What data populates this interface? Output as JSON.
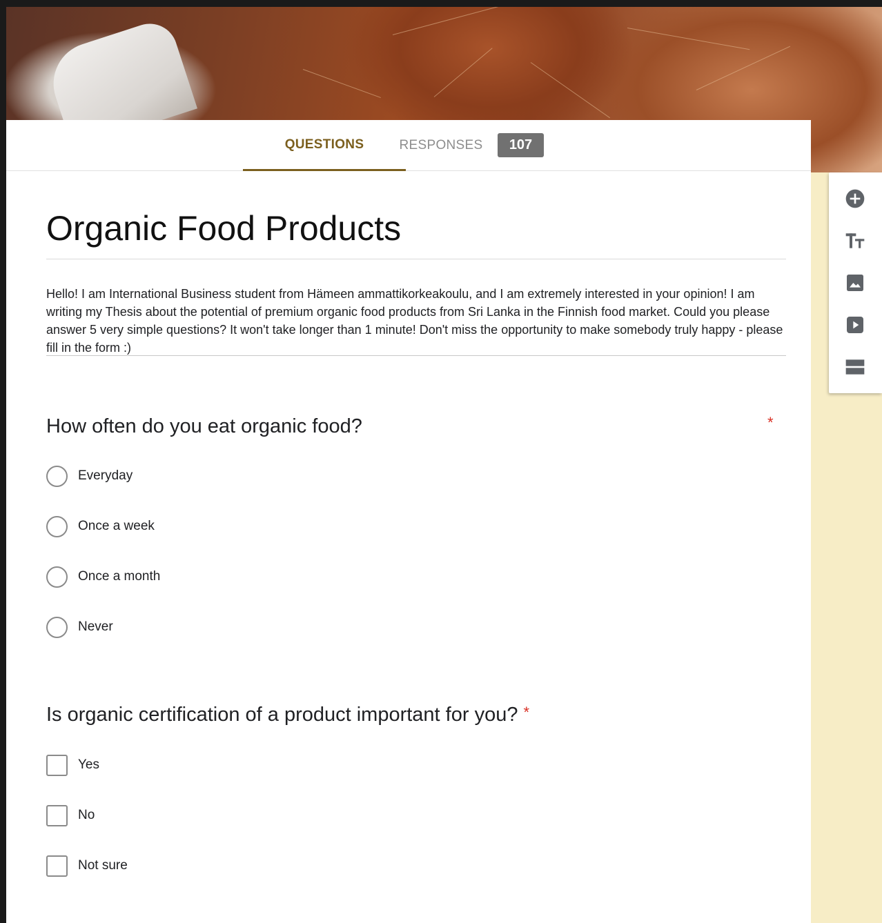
{
  "tabs": {
    "questions_label": "QUESTIONS",
    "responses_label": "RESPONSES",
    "responses_count": "107"
  },
  "form": {
    "title": "Organic Food Products",
    "description": "Hello! I am International Business student from Hämeen ammattikorkeakoulu, and I am extremely interested in your opinion! I am writing my Thesis about the potential of premium organic food products from Sri Lanka in the Finnish food market. Could you please answer 5 very simple questions? It won't take longer than 1 minute! Don't miss the opportunity to make somebody truly happy - please fill in the form :)"
  },
  "questions": [
    {
      "text": "How often do you eat organic food?",
      "required_mark": "*",
      "type": "radio",
      "options": [
        "Everyday",
        "Once a week",
        "Once a month",
        "Never"
      ]
    },
    {
      "text": "Is organic certification of a product important for you?",
      "required_mark": "*",
      "type": "checkbox",
      "options": [
        "Yes",
        "No",
        "Not sure"
      ]
    }
  ],
  "toolbar": {
    "icons": [
      "add-question-icon",
      "add-title-icon",
      "add-image-icon",
      "add-video-icon",
      "add-section-icon"
    ]
  },
  "colors": {
    "accent": "#7b5f1e",
    "side_background": "#f7edc6",
    "required": "#d93025",
    "badge": "#717171"
  }
}
